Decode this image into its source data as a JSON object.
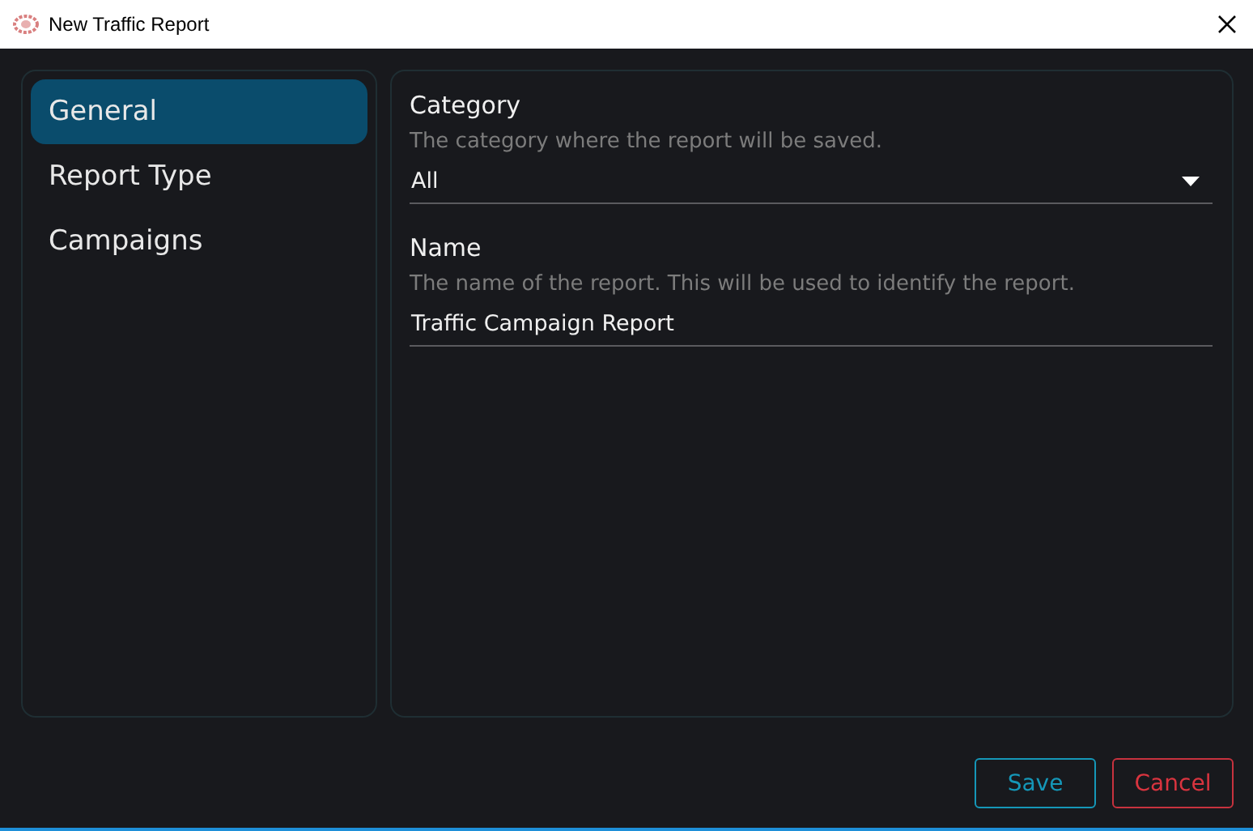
{
  "window": {
    "title": "New Traffic Report"
  },
  "sidebar": {
    "items": [
      {
        "label": "General",
        "selected": true
      },
      {
        "label": "Report Type",
        "selected": false
      },
      {
        "label": "Campaigns",
        "selected": false
      }
    ]
  },
  "fields": [
    {
      "kind": "dropdown",
      "label": "Category",
      "description": "The category where the report will be saved.",
      "value": "All"
    },
    {
      "kind": "text",
      "label": "Name",
      "description": "The name of the report. This will be used to identify the report.",
      "value": "Traffic Campaign Report"
    }
  ],
  "buttons": [
    {
      "kind": "save",
      "label": "Save"
    },
    {
      "kind": "cancel",
      "label": "Cancel"
    }
  ]
}
